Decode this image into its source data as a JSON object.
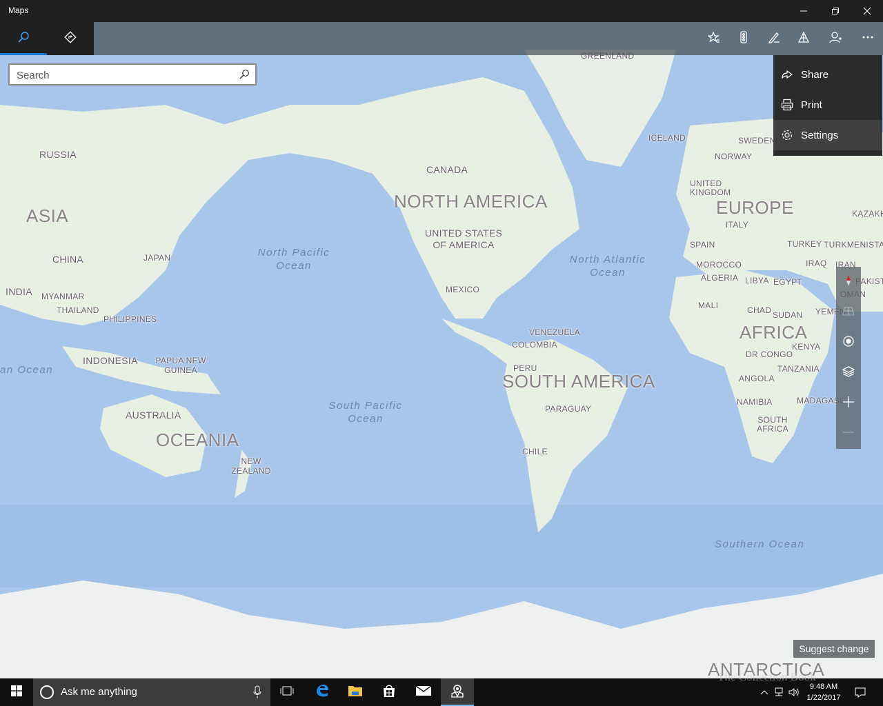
{
  "window": {
    "title": "Maps"
  },
  "toolbar": {
    "left": [
      {
        "name": "search-tab",
        "icon": "search-icon",
        "active": true
      },
      {
        "name": "directions-tab",
        "icon": "directions-icon",
        "active": false
      }
    ],
    "right_icons": [
      "favorites-icon",
      "traffic-icon",
      "ink-icon",
      "3d-cities-icon",
      "account-icon",
      "more-icon"
    ]
  },
  "search": {
    "placeholder": "Search",
    "value": ""
  },
  "menu": {
    "items": [
      {
        "label": "Share",
        "icon": "share-icon"
      },
      {
        "label": "Print",
        "icon": "print-icon"
      },
      {
        "label": "Settings",
        "icon": "settings-icon"
      }
    ]
  },
  "map_labels": {
    "greenland": "GREENLAND",
    "iceland": "ICELAND",
    "sweden": "SWEDEN",
    "norway": "NORWAY",
    "uk": "UNITED KINGDOM",
    "europe": "EUROPE",
    "italy": "ITALY",
    "spain": "SPAIN",
    "turkey": "TURKEY",
    "turkmenistan": "TURKMENISTAN",
    "kazakhstan": "KAZAKH",
    "iraq": "IRAQ",
    "iran": "IRAN",
    "pakistan": "PAKIST",
    "oman": "OMAN",
    "yemen": "YEMEN",
    "morocco": "MOROCCO",
    "algeria": "ALGERIA",
    "libya": "LIBYA",
    "egypt": "EGYPT",
    "mali": "MALI",
    "chad": "CHAD",
    "sudan": "SUDAN",
    "africa": "AFRICA",
    "dr_congo": "DR CONGO",
    "kenya": "KENYA",
    "tanzania": "TANZANIA",
    "angola": "ANGOLA",
    "namibia": "NAMIBIA",
    "madagascar": "MADAGASC",
    "south_africa": "SOUTH AFRICA",
    "russia": "RUSSIA",
    "asia": "ASIA",
    "china": "CHINA",
    "japan": "JAPAN",
    "india": "INDIA",
    "myanmar": "MYANMAR",
    "thailand": "THAILAND",
    "philippines": "PHILIPPINES",
    "indonesia": "INDONESIA",
    "papua": "PAPUA NEW GUINEA",
    "australia": "AUSTRALIA",
    "oceania": "OCEANIA",
    "new_zealand": "NEW ZEALAND",
    "canada": "CANADA",
    "north_america": "NORTH AMERICA",
    "usa": "UNITED STATES OF AMERICA",
    "mexico": "MEXICO",
    "venezuela": "VENEZUELA",
    "colombia": "COLOMBIA",
    "peru": "PERU",
    "south_america": "SOUTH AMERICA",
    "paraguay": "PARAGUAY",
    "chile": "CHILE",
    "antarctica": "ANTARCTICA",
    "north_pacific": "North Pacific Ocean",
    "south_pacific": "South Pacific Ocean",
    "north_atlantic": "North Atlantic Ocean",
    "southern_ocean": "Southern Ocean",
    "indian_ocean": "an Ocean"
  },
  "map_controls": [
    "compass-icon",
    "tilt-icon",
    "locate-icon",
    "layers-icon",
    "zoom-in-icon",
    "zoom-out-icon"
  ],
  "suggest_change": "Suggest change",
  "taskbar": {
    "cortana_text": "Ask me anything",
    "apps": [
      "task-view-icon",
      "edge-icon",
      "file-explorer-icon",
      "store-icon",
      "mail-icon",
      "maps-icon"
    ],
    "time": "9:48 AM",
    "date": "1/22/2017"
  },
  "watermark": "The Collection Book"
}
